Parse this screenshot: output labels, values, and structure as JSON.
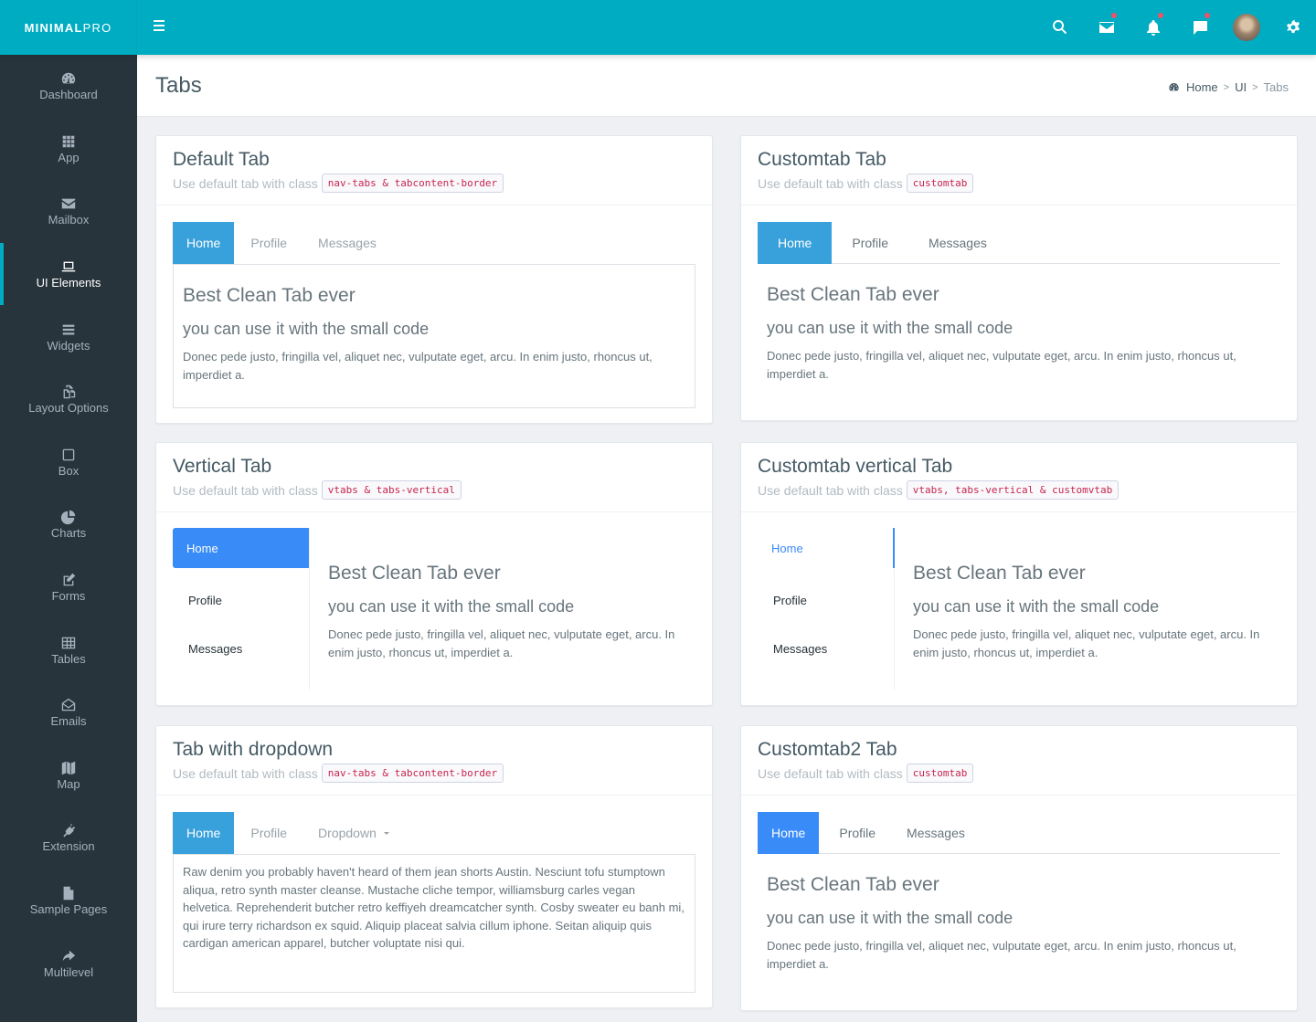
{
  "brand": {
    "bold": "MINIMAL",
    "light": "PRO"
  },
  "header": {
    "icons": [
      "search-icon",
      "mail-icon",
      "bell-icon",
      "chat-icon",
      "avatar",
      "gear-icon"
    ],
    "notification_color": "#ef5369",
    "accent": "#00acc1"
  },
  "sidebar": {
    "items": [
      {
        "label": "Dashboard",
        "icon": "dashboard-icon"
      },
      {
        "label": "App",
        "icon": "grid-icon"
      },
      {
        "label": "Mailbox",
        "icon": "envelope-icon"
      },
      {
        "label": "UI Elements",
        "icon": "laptop-icon",
        "active": true
      },
      {
        "label": "Widgets",
        "icon": "bars-icon"
      },
      {
        "label": "Layout Options",
        "icon": "copy-icon"
      },
      {
        "label": "Box",
        "icon": "square-icon"
      },
      {
        "label": "Charts",
        "icon": "pie-chart-icon"
      },
      {
        "label": "Forms",
        "icon": "edit-icon"
      },
      {
        "label": "Tables",
        "icon": "table-icon"
      },
      {
        "label": "Emails",
        "icon": "envelope-open-icon"
      },
      {
        "label": "Map",
        "icon": "map-icon"
      },
      {
        "label": "Extension",
        "icon": "plug-icon"
      },
      {
        "label": "Sample Pages",
        "icon": "file-icon"
      },
      {
        "label": "Multilevel",
        "icon": "share-icon"
      }
    ]
  },
  "page": {
    "title": "Tabs",
    "breadcrumb": [
      "Home",
      "UI",
      "Tabs"
    ]
  },
  "common": {
    "sub_prefix": "Use default tab with class",
    "pane_h3": "Best Clean Tab ever",
    "pane_h4": "you can use it with the small code",
    "pane_p": "Donec pede justo, fringilla vel, aliquet nec, vulputate eget, arcu. In enim justo, rhoncus ut, imperdiet a."
  },
  "boxes": {
    "default": {
      "title": "Default Tab",
      "code": "nav-tabs & tabcontent-border",
      "tabs": [
        "Home",
        "Profile",
        "Messages"
      ]
    },
    "custom": {
      "title": "Customtab Tab",
      "code": "customtab",
      "tabs": [
        "Home",
        "Profile",
        "Messages"
      ]
    },
    "vertical": {
      "title": "Vertical Tab",
      "code": "vtabs & tabs-vertical",
      "tabs": [
        "Home",
        "Profile",
        "Messages"
      ]
    },
    "customvertical": {
      "title": "Customtab vertical Tab",
      "code": "vtabs, tabs-vertical & customvtab",
      "tabs": [
        "Home",
        "Profile",
        "Messages"
      ]
    },
    "dropdown": {
      "title": "Tab with dropdown",
      "code": "nav-tabs & tabcontent-border",
      "tabs": [
        "Home",
        "Profile",
        "Dropdown"
      ],
      "content": "Raw denim you probably haven't heard of them jean shorts Austin. Nesciunt tofu stumptown aliqua, retro synth master cleanse. Mustache cliche tempor, williamsburg carles vegan helvetica. Reprehenderit butcher retro keffiyeh dreamcatcher synth. Cosby sweater eu banh mi, qui irure terry richardson ex squid. Aliquip placeat salvia cillum iphone. Seitan aliquip quis cardigan american apparel, butcher voluptate nisi qui."
    },
    "custom2": {
      "title": "Customtab2 Tab",
      "code": "customtab",
      "tabs": [
        "Home",
        "Profile",
        "Messages"
      ]
    }
  }
}
